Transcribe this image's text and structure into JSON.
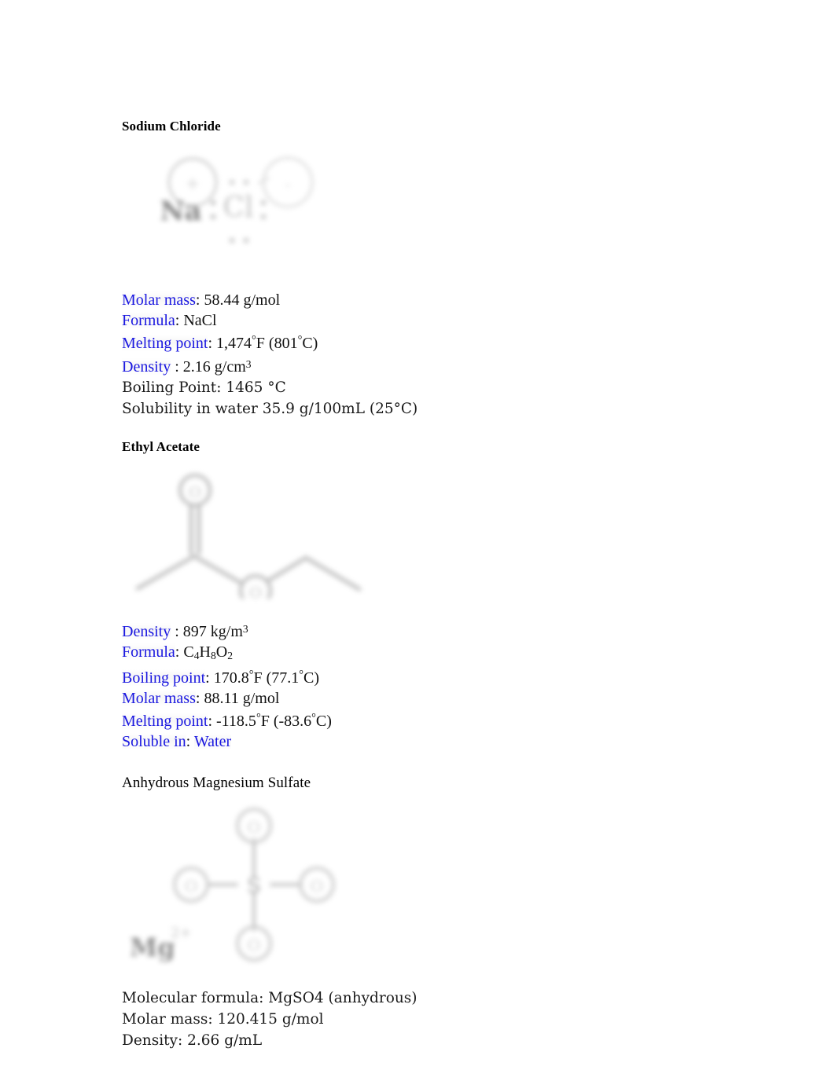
{
  "document": {
    "background_color": "#ffffff",
    "text_color": "#000000",
    "link_color": "#1a17e0"
  },
  "sections": [
    {
      "heading": "Sodium Chloride",
      "heading_style": "bold",
      "structure_name": "sodium-chloride-lewis-structure",
      "properties": [
        {
          "label": "Molar mass",
          "separator": ": ",
          "value": "58.44 g/mol",
          "label_link": true,
          "value_link": false
        },
        {
          "label": "Formula",
          "separator": ": ",
          "value": "NaCl",
          "label_link": true,
          "value_link": false
        },
        {
          "label": "Melting point",
          "separator": ": ",
          "value": "1,474°F (801°C)",
          "label_link": true,
          "value_link": false
        },
        {
          "label": "Density",
          "separator": " : ",
          "value": "2.16 g/cm³",
          "label_link": true,
          "value_link": false
        },
        {
          "label": "Boiling Point",
          "separator": ": ",
          "value": "1465 °C",
          "label_link": false,
          "value_link": false
        },
        {
          "label": "Solubility in water",
          "separator": " ",
          "value": "35.9 g/100mL (25°C)",
          "label_link": false,
          "value_link": false
        }
      ]
    },
    {
      "heading": "Ethyl Acetate",
      "heading_style": "bold",
      "structure_name": "ethyl-acetate-skeletal-structure",
      "properties": [
        {
          "label": "Density",
          "separator": " : ",
          "value": "897 kg/m³",
          "label_link": true,
          "value_link": false
        },
        {
          "label": "Formula",
          "separator": ": ",
          "value": "C4H8O2",
          "label_link": true,
          "value_link": false
        },
        {
          "label": "Boiling point",
          "separator": ": ",
          "value": "170.8°F (77.1°C)",
          "label_link": true,
          "value_link": false
        },
        {
          "label": "Molar mass",
          "separator": ": ",
          "value": "88.11 g/mol",
          "label_link": true,
          "value_link": false
        },
        {
          "label": "Melting point",
          "separator": ": ",
          "value": "-118.5°F (-83.6°C)",
          "label_link": true,
          "value_link": false
        },
        {
          "label": "Soluble in",
          "separator": ": ",
          "value": "Water",
          "label_link": true,
          "value_link": true
        }
      ]
    },
    {
      "heading": "Anhydrous Magnesium Sulfate",
      "heading_style": "plain",
      "structure_name": "magnesium-sulfate-structure",
      "properties": [
        {
          "label": "Molecular formula",
          "separator": ": ",
          "value": "MgSO4 (anhydrous)",
          "label_link": false,
          "value_link": false
        },
        {
          "label": "Molar mass",
          "separator": ": ",
          "value": "120.415 g/mol",
          "label_link": false,
          "value_link": false
        },
        {
          "label": "Density",
          "separator": ": ",
          "value": "2.66 g/mL",
          "label_link": false,
          "value_link": false
        }
      ]
    }
  ],
  "nacl_structure": {
    "cation_label": "Na",
    "cation_charge": "+",
    "anion_label": "Cl",
    "anion_charge": "-"
  },
  "ethyl_acetate_structure": {
    "carbonyl_oxygen": "O",
    "ester_oxygen": "O"
  },
  "mgso4_structure": {
    "center_atom": "S",
    "oxygen_top": "O",
    "oxygen_bottom": "O",
    "oxygen_left": "O",
    "oxygen_right": "O",
    "counter_ion": "Mg",
    "counter_ion_charge": "2+"
  }
}
